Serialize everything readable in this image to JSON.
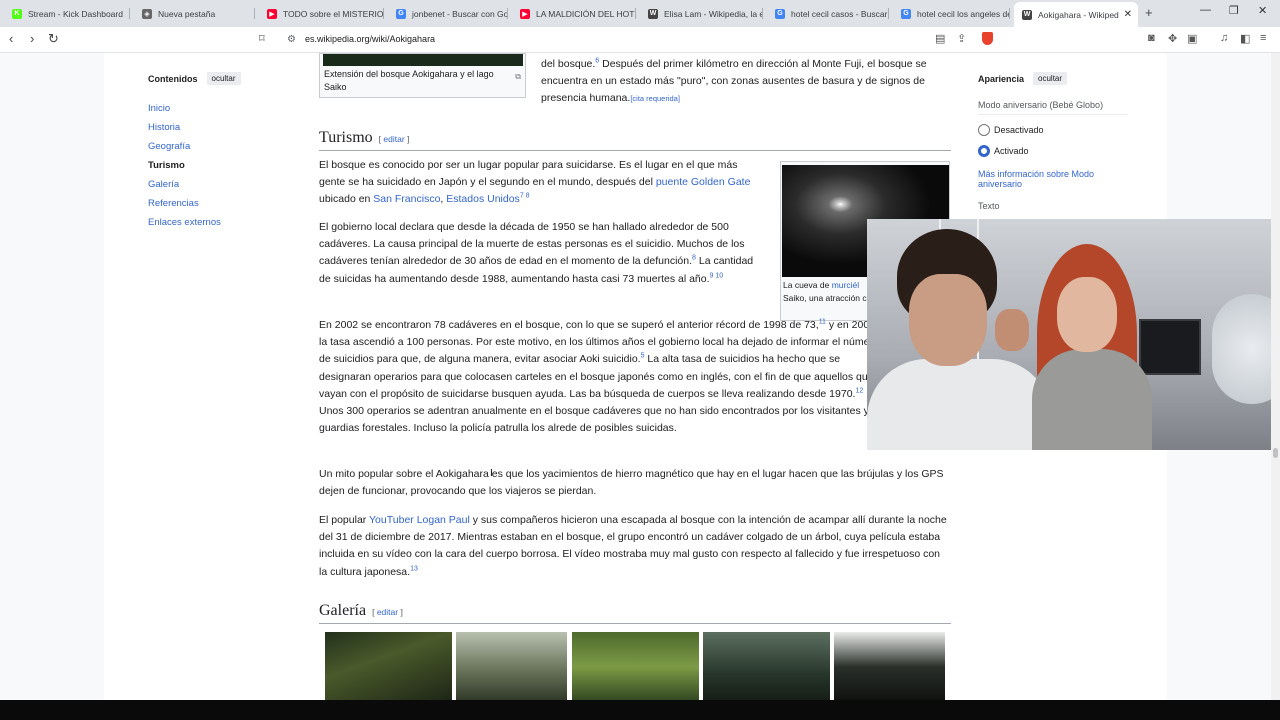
{
  "browser": {
    "tabs": [
      {
        "title": "Stream - Kick Dashboard",
        "icon": "kick-icon",
        "color": "#53fc18",
        "glyph": "K"
      },
      {
        "title": "Nueva pestaña",
        "icon": "shield-icon",
        "color": "#666666",
        "glyph": "◈"
      },
      {
        "title": "TODO sobre el MISTERIOS",
        "icon": "youtube-icon",
        "color": "#ff0033",
        "glyph": "▶"
      },
      {
        "title": "jonbenet - Buscar con Go",
        "icon": "google-icon",
        "color": "#4285f4",
        "glyph": "G"
      },
      {
        "title": "LA MALDICIÓN DEL HOTE",
        "icon": "youtube-icon",
        "color": "#ff0033",
        "glyph": "▶"
      },
      {
        "title": "Elisa Lam - Wikipedia, la e",
        "icon": "wikipedia-icon",
        "color": "#444444",
        "glyph": "W"
      },
      {
        "title": "hotel cecil casos - Buscar",
        "icon": "google-icon",
        "color": "#4285f4",
        "glyph": "G"
      },
      {
        "title": "hotel cecil los angeles de",
        "icon": "google-icon",
        "color": "#4285f4",
        "glyph": "G"
      },
      {
        "title": "Aokigahara - Wikiped",
        "icon": "wikipedia-icon",
        "color": "#444444",
        "glyph": "W"
      }
    ],
    "url": "es.wikipedia.org/wiki/Aokigahara"
  },
  "toc": {
    "title": "Contenidos",
    "hide_label": "ocultar",
    "items": [
      "Inicio",
      "Historia",
      "Geografía",
      "Turismo",
      "Galería",
      "Referencias",
      "Enlaces externos"
    ]
  },
  "appearance": {
    "title": "Apariencia",
    "hide_label": "ocultar",
    "mode_label": "Modo aniversario (Bebé Globo)",
    "option_off": "Desactivado",
    "option_on": "Activado",
    "more_info": "Más información sobre Modo aniversario",
    "text_label": "Texto"
  },
  "article": {
    "top_caption": "Extensión del bosque Aokigahara y el lago Saiko",
    "top_text_a": "del bosque.",
    "top_text_ref": "6",
    "top_text_b": " Después del primer kilómetro en dirección al Monte Fuji, el bosque se encuentra en un estado más \"puro\", con zonas ausentes de basura y de signos de presencia humana.",
    "cita": "[cita requerida]",
    "h_turismo": "Turismo",
    "edit_label": "editar",
    "p1_a": "El bosque es conocido por ser un lugar popular para suicidarse. Es el lugar en el que más gente se ha suicidado en Japón y el segundo en el mundo, después del ",
    "p1_link1": "puente Golden Gate",
    "p1_b": " ubicado en ",
    "p1_link2": "San Francisco",
    "p1_c": ", ",
    "p1_link3": "Estados Unidos",
    "p1_ref": "7 8",
    "p2_a": "El gobierno local declara que desde la década de 1950 se han hallado alrededor de 500 cadáveres. La causa principal de la muerte de estas personas es el suicidio. Muchos de los cadáveres tenían alrededor de 30 años de edad en el momento de la defunción.",
    "p2_ref1": "8",
    "p2_b": " La cantidad de suicidas ha aumentando desde 1988, aumentando hasta casi 73 muertes al año.",
    "p2_ref2": "9 10",
    "p3_a": "En 2002 se encontraron 78 cadáveres en el bosque, con lo que se superó el anterior récord de 1998 de 73,",
    "p3_ref1": "11",
    "p3_b": " y en 2003 la tasa ascendió a 100 personas. Por este motivo, en los últimos años el gobierno local ha dejado de informar el número de suicidios para que, de alguna manera, evitar asociar Aoki suicidio.",
    "p3_ref2": "5",
    "p3_c": " La alta tasa de suicidios ha hecho que se designaran operarios para que colocasen carteles en el bosque japonés como en inglés, con el fin de que aquellos que vayan con el propósito de suicidarse busquen ayuda. Las ba búsqueda de cuerpos se lleva realizando desde 1970.",
    "p3_ref3": "12",
    "p3_d": " Unos 300 operarios se adentran anualmente en el bosque cadáveres que no han sido encontrados por los visitantes y guardias forestales. Incluso la policía patrulla los alrede de posibles suicidas.",
    "p4": "Un mito popular sobre el Aokigahara es que los yacimientos de hierro magnético que hay en el lugar hacen que las brújulas y los GPS dejen de funcionar, provocando que los viajeros se pierdan.",
    "p5_a": "El popular ",
    "p5_link": "YouTuber Logan Paul",
    "p5_b": " y sus compañeros hicieron una escapada al bosque con la intención de acampar allí durante la noche del 31 de diciembre de 2017. Mientras estaban en el bosque, el grupo encontró un cadáver colgado de un árbol, cuya película estaba incluida en su vídeo con la cara del cuerpo borrosa. El vídeo mostraba muy mal gusto con respecto al fallecido y fue irrespetuoso con la cultura japonesa.",
    "p5_ref": "13",
    "cave_cap_a": "La cueva de ",
    "cave_cap_link": "murciél",
    "cave_cap_b": "Saiko, una atracción cercanías de Aokigah",
    "h_galeria": "Galería"
  },
  "colors": {
    "link": "#3366cc",
    "tabstrip": "#dfe3e8",
    "accent_radio": "#3366cc"
  }
}
